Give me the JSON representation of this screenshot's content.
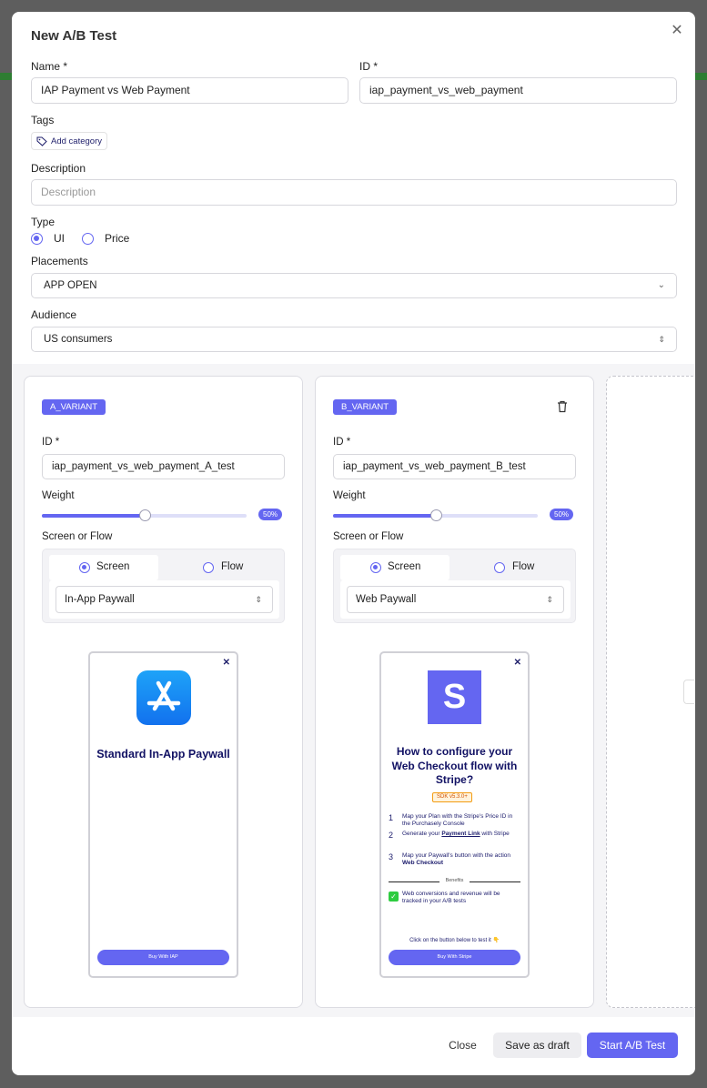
{
  "modal": {
    "title": "New A/B Test"
  },
  "form": {
    "name_label": "Name *",
    "name_value": "IAP Payment vs Web Payment",
    "id_label": "ID *",
    "id_value": "iap_payment_vs_web_payment",
    "tags_label": "Tags",
    "add_category": "Add category",
    "description_label": "Description",
    "description_placeholder": "Description",
    "type_label": "Type",
    "type_options": [
      "UI",
      "Price"
    ],
    "type_selected": "UI",
    "placements_label": "Placements",
    "placements_value": "APP OPEN",
    "audience_label": "Audience",
    "audience_value": "US consumers"
  },
  "variants": [
    {
      "badge": "A_VARIANT",
      "id_label": "ID *",
      "id_value": "iap_payment_vs_web_payment_A_test",
      "weight_label": "Weight",
      "weight_percent": 50,
      "weight_text": "50%",
      "sf_label": "Screen or Flow",
      "tabs": [
        "Screen",
        "Flow"
      ],
      "selected_tab": "Screen",
      "screen_value": "In-App Paywall",
      "preview": {
        "title": "Standard In-App Paywall",
        "button": "Buy With IAP",
        "close": "✕"
      }
    },
    {
      "badge": "B_VARIANT",
      "id_label": "ID *",
      "id_value": "iap_payment_vs_web_payment_B_test",
      "weight_label": "Weight",
      "weight_percent": 50,
      "weight_text": "50%",
      "sf_label": "Screen or Flow",
      "tabs": [
        "Screen",
        "Flow"
      ],
      "selected_tab": "Screen",
      "screen_value": "Web Paywall",
      "preview": {
        "logo_letter": "S",
        "title": "How to configure your Web Checkout flow with Stripe?",
        "sdk": "SDK v5.3.0+",
        "steps": [
          {
            "n": "1",
            "text": "Map your Plan with the Stripe's Price ID in the Purchasely Console"
          },
          {
            "n": "2",
            "pre": "Generate your ",
            "bold": "Payment Link",
            "post": " with Stripe"
          },
          {
            "n": "3",
            "pre": "Map your Paywall's button with the action ",
            "bold": "Web Checkout",
            "post": ""
          }
        ],
        "benefits_label": "Benefits",
        "benefit_text": "Web conversions and revenue will be tracked in your A/B tests",
        "click_hint": "Click on the button below to test it 👇",
        "button": "Buy With Stripe",
        "close": "✕"
      }
    }
  ],
  "footer": {
    "close": "Close",
    "save_draft": "Save as draft",
    "start": "Start A/B Test"
  },
  "colors": {
    "accent": "#6466f1",
    "title_text": "#121264"
  }
}
